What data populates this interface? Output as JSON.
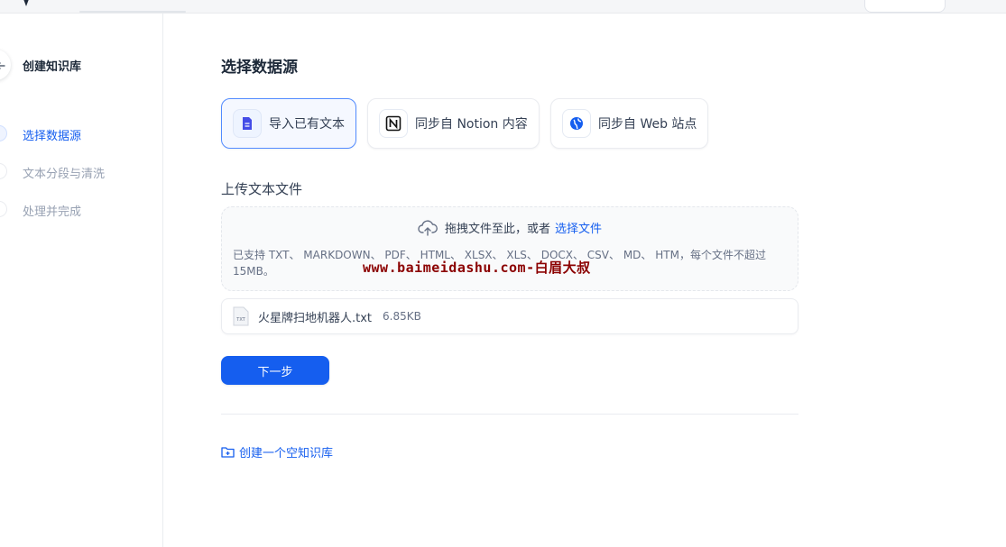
{
  "colors": {
    "accent": "#155eef",
    "watermark": "#8b0000"
  },
  "sidebar": {
    "title": "创建知识库",
    "back_icon": "arrow-left-icon",
    "steps": [
      {
        "label": "选择数据源",
        "state": "active"
      },
      {
        "label": "文本分段与清洗",
        "state": "inactive"
      },
      {
        "label": "处理并完成",
        "state": "inactive"
      }
    ]
  },
  "main": {
    "title": "选择数据源",
    "sources": [
      {
        "label": "导入已有文本",
        "icon": "document-icon",
        "selected": true
      },
      {
        "label": "同步自 Notion 内容",
        "icon": "notion-icon",
        "selected": false
      },
      {
        "label": "同步自 Web 站点",
        "icon": "web-icon",
        "selected": false
      }
    ],
    "upload": {
      "section_label": "上传文本文件",
      "drop_text": "拖拽文件至此，或者",
      "select_link": "选择文件",
      "hint": "已支持 TXT、 MARKDOWN、 PDF、 HTML、 XLSX、 XLS、 DOCX、 CSV、 MD、 HTM，每个文件不超过 15MB。",
      "upload_icon": "cloud-upload-icon"
    },
    "file": {
      "name": "火星牌扫地机器人.txt",
      "size": "6.85KB",
      "badge": "TXT"
    },
    "next_button": "下一步",
    "create_empty": "创建一个空知识库"
  },
  "watermark": "www.baimeidashu.com-白眉大叔"
}
